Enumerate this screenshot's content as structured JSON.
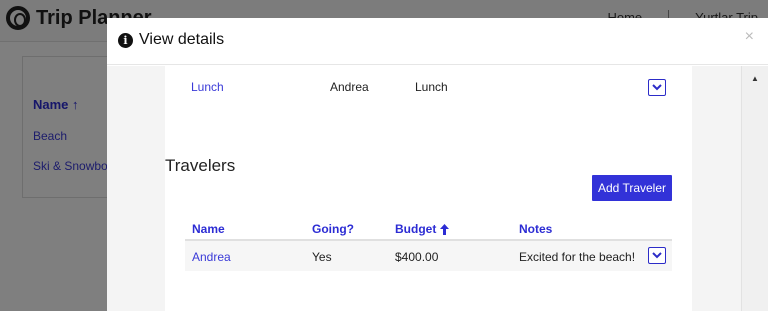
{
  "app": {
    "brand_name": "Trip Planner",
    "nav": [
      "Home",
      "Yurtlar Trip"
    ]
  },
  "side_table": {
    "header": "Name",
    "rows": [
      "Beach",
      "Ski & Snowboard"
    ]
  },
  "modal": {
    "title": "View details",
    "close_label": "×"
  },
  "activity_row": {
    "name": "Lunch",
    "person": "Andrea",
    "type": "Lunch"
  },
  "travelers": {
    "section_title": "Travelers",
    "add_button_label": "Add Traveler",
    "columns": [
      "Name",
      "Going?",
      "Budget",
      "Notes"
    ],
    "sorted_column": "Budget",
    "sort_direction": "ascending",
    "rows": [
      {
        "name": "Andrea",
        "going": "Yes",
        "budget": "$400.00",
        "notes": "Excited for the beach!"
      }
    ]
  },
  "colors": {
    "accent": "#3232d8",
    "link": "#3a3ad8"
  }
}
